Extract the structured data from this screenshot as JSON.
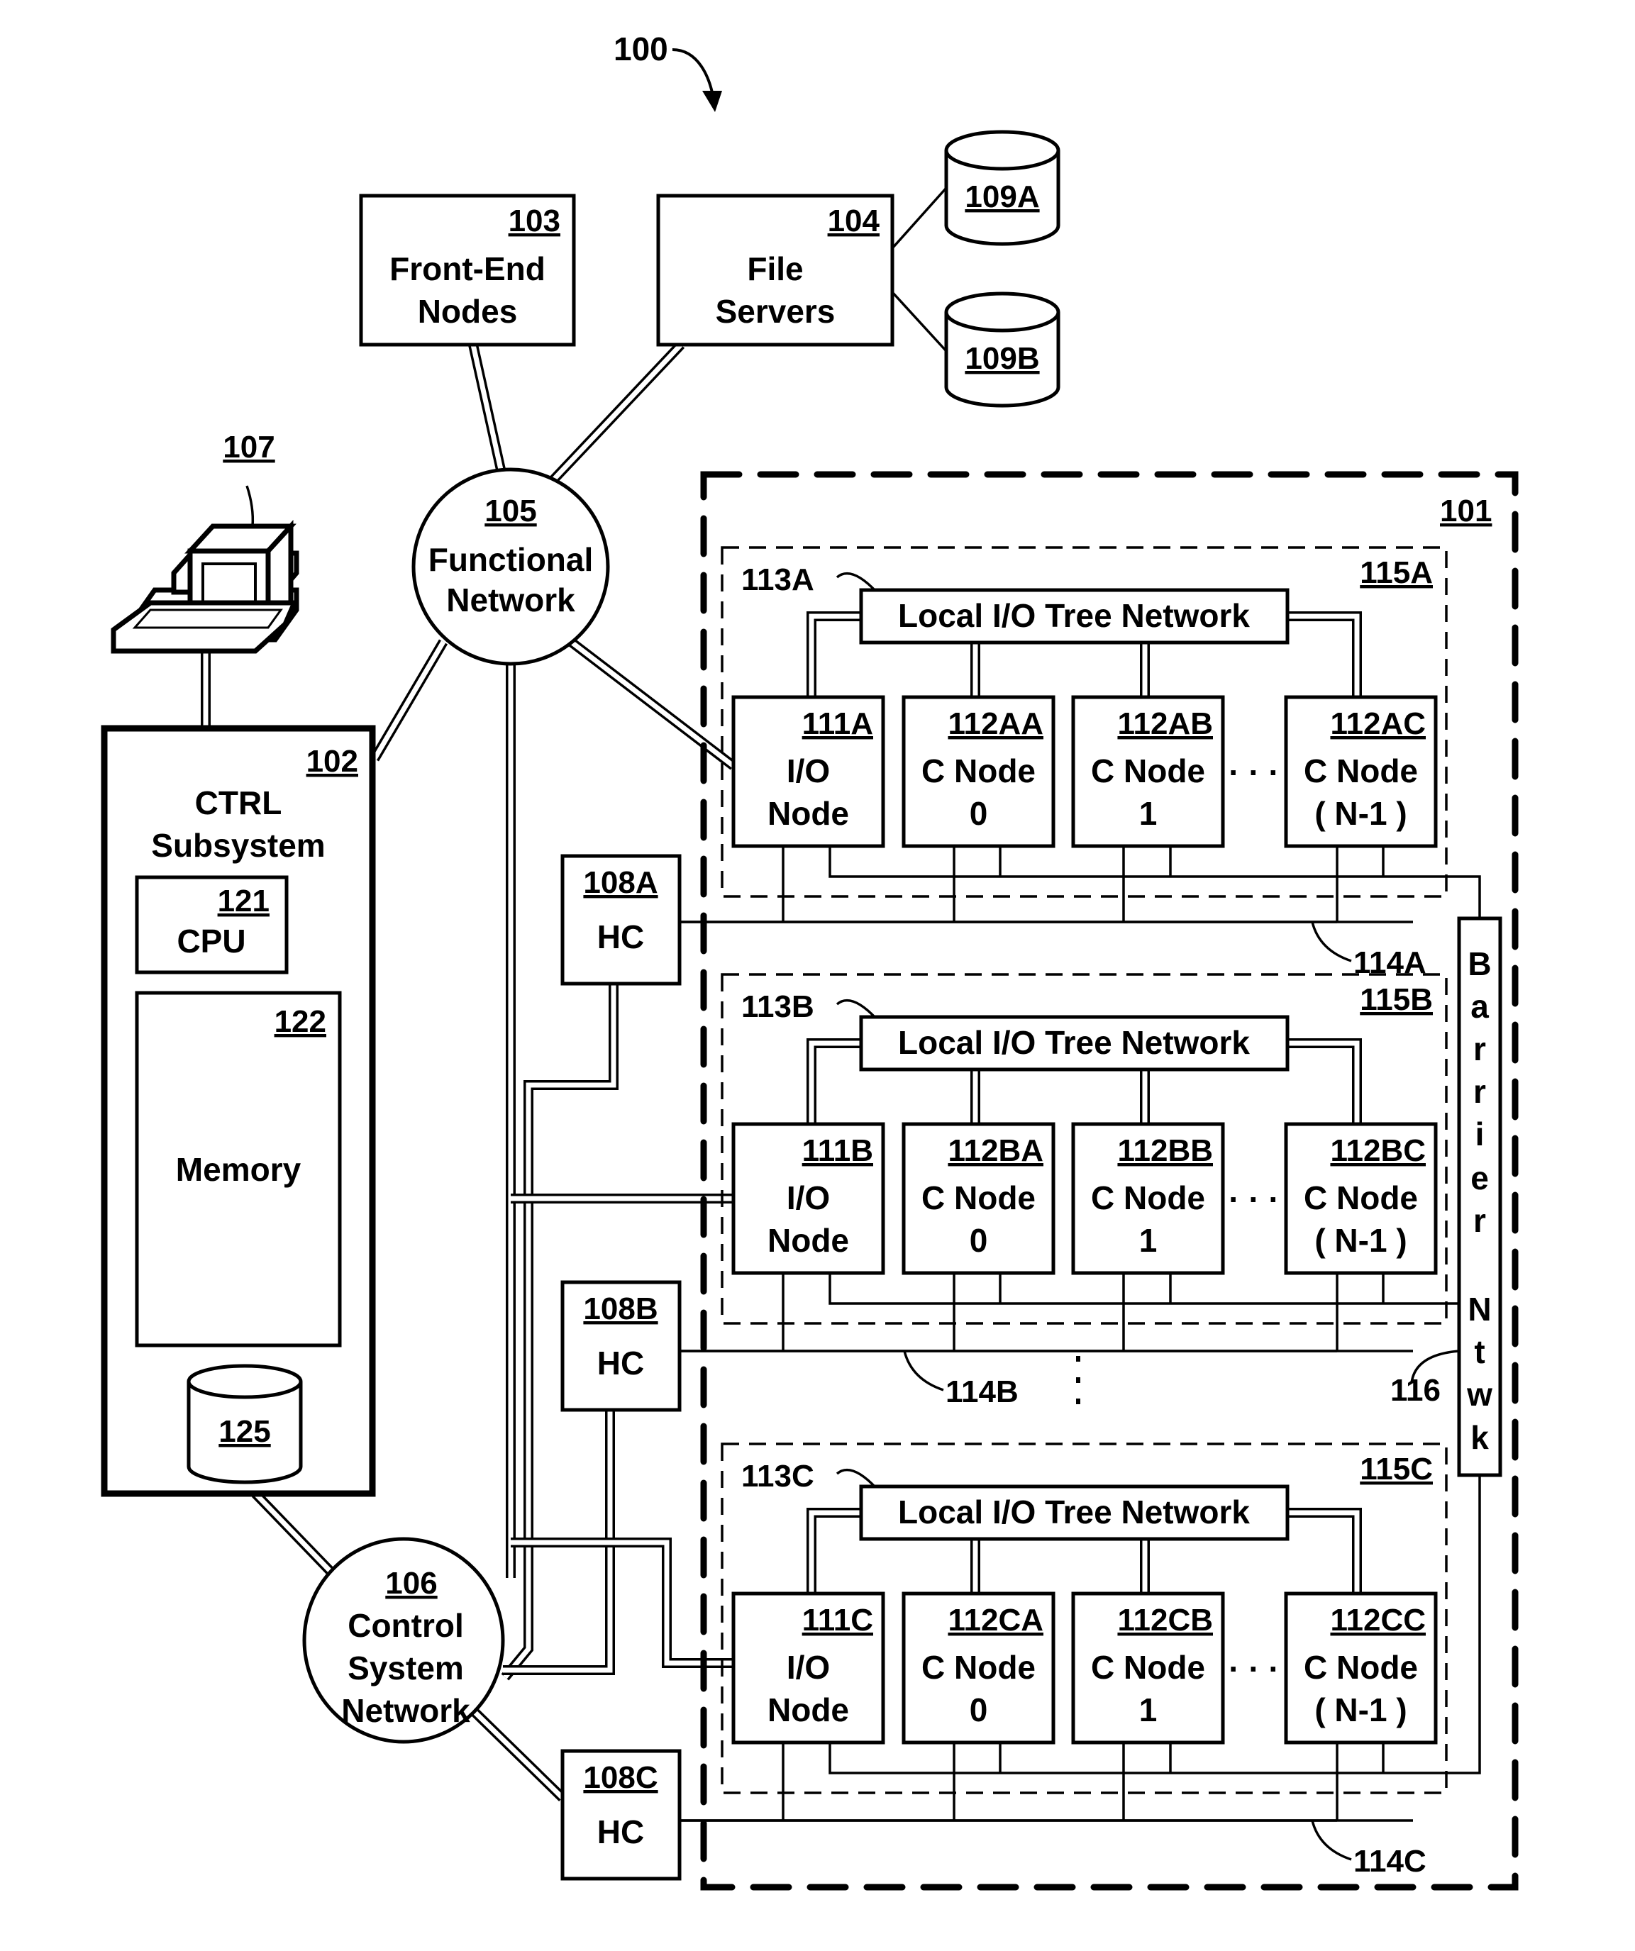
{
  "figure": {
    "ref": "100",
    "system_ref": "101"
  },
  "front_end": {
    "ref": "103",
    "line1": "Front-End",
    "line2": "Nodes"
  },
  "file_servers": {
    "ref": "104",
    "line1": "File",
    "line2": "Servers"
  },
  "storage": [
    {
      "ref": "109A"
    },
    {
      "ref": "109B"
    }
  ],
  "functional_network": {
    "ref": "105",
    "line1": "Functional",
    "line2": "Network"
  },
  "terminal": {
    "ref": "107"
  },
  "ctrl_subsystem": {
    "ref": "102",
    "line1": "CTRL",
    "line2": "Subsystem",
    "cpu": {
      "ref": "121",
      "label": "CPU"
    },
    "memory": {
      "ref": "122",
      "label": "Memory"
    },
    "storage": {
      "ref": "125"
    }
  },
  "control_network": {
    "ref": "106",
    "line1": "Control",
    "line2": "System",
    "line3": "Network"
  },
  "hardware_controllers": [
    {
      "ref": "108A",
      "label": "HC"
    },
    {
      "ref": "108B",
      "label": "HC"
    },
    {
      "ref": "108C",
      "label": "HC"
    }
  ],
  "barrier_network": {
    "ref": "116",
    "letters": [
      "B",
      "a",
      "r",
      "r",
      "i",
      "e",
      "r",
      "N",
      "t",
      "w",
      "k"
    ]
  },
  "continuation_dots": "·",
  "racks": [
    {
      "ref": "115A",
      "tree_ref": "113A",
      "bus_ref": "114A",
      "tree_label": "Local I/O Tree Network",
      "nodes": [
        {
          "ref": "111A",
          "line1": "I/O",
          "line2": "Node"
        },
        {
          "ref": "112AA",
          "line1": "C Node",
          "line2": "0"
        },
        {
          "ref": "112AB",
          "line1": "C Node",
          "line2": "1"
        },
        {
          "ref": "112AC",
          "line1": "C Node",
          "line2": "( N-1 )"
        }
      ]
    },
    {
      "ref": "115B",
      "tree_ref": "113B",
      "bus_ref": "114B",
      "tree_label": "Local I/O Tree Network",
      "nodes": [
        {
          "ref": "111B",
          "line1": "I/O",
          "line2": "Node"
        },
        {
          "ref": "112BA",
          "line1": "C Node",
          "line2": "0"
        },
        {
          "ref": "112BB",
          "line1": "C Node",
          "line2": "1"
        },
        {
          "ref": "112BC",
          "line1": "C Node",
          "line2": "( N-1 )"
        }
      ]
    },
    {
      "ref": "115C",
      "tree_ref": "113C",
      "bus_ref": "114C",
      "tree_label": "Local I/O Tree Network",
      "nodes": [
        {
          "ref": "111C",
          "line1": "I/O",
          "line2": "Node"
        },
        {
          "ref": "112CA",
          "line1": "C Node",
          "line2": "0"
        },
        {
          "ref": "112CB",
          "line1": "C Node",
          "line2": "1"
        },
        {
          "ref": "112CC",
          "line1": "C Node",
          "line2": "( N-1 )"
        }
      ]
    }
  ]
}
